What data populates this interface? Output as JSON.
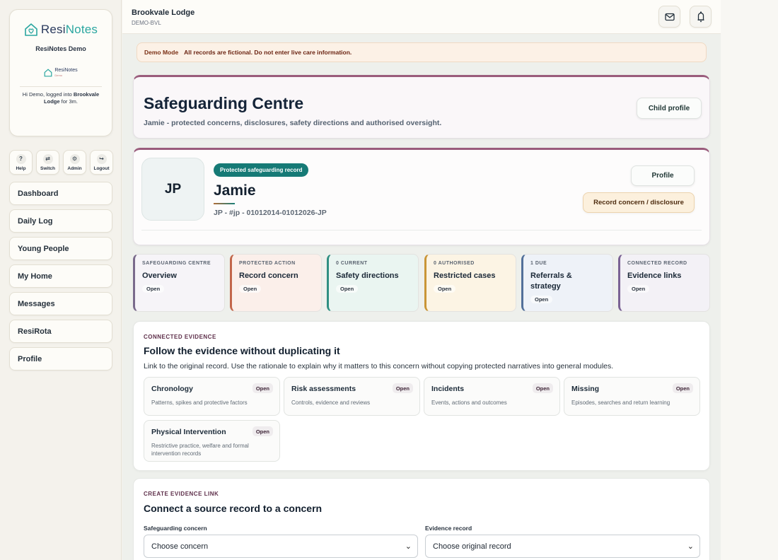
{
  "sidebar": {
    "brand_name_a": "Resi",
    "brand_name_b": "Notes",
    "org_name": "ResiNotes Demo",
    "mini_logo_a": "ResiNotes",
    "mini_logo_b": "Demo",
    "login_prefix": "Hi Demo, logged into ",
    "login_home": "Brookvale Lodge",
    "login_suffix": " for 3m.",
    "quick": [
      {
        "icon": "?",
        "label": "Help"
      },
      {
        "icon": "⇄",
        "label": "Switch"
      },
      {
        "icon": "⚙",
        "label": "Admin"
      },
      {
        "icon": "↪",
        "label": "Logout"
      }
    ],
    "nav": [
      "Dashboard",
      "Daily Log",
      "Young People",
      "My Home",
      "Messages",
      "ResiRota",
      "Profile"
    ]
  },
  "topbar": {
    "home_name": "Brookvale Lodge",
    "home_code": "DEMO-BVL"
  },
  "banner": {
    "tag": "Demo Mode",
    "message": "All records are fictional. Do not enter live care information."
  },
  "hero": {
    "title": "Safeguarding Centre",
    "subtitle": "Jamie - protected concerns, disclosures, safety directions and authorised oversight.",
    "child_profile_btn": "Child profile"
  },
  "child": {
    "initials": "JP",
    "badge": "Protected safeguarding record",
    "name": "Jamie",
    "identifier": "JP - #jp - 01012014-01012026-JP",
    "profile_btn": "Profile",
    "record_btn": "Record concern / disclosure"
  },
  "tiles": [
    {
      "kicker": "SAFEGUARDING CENTRE",
      "title": "Overview",
      "open": "Open",
      "border": "#7a6a8c",
      "bg": "#f6f4f8"
    },
    {
      "kicker": "PROTECTED ACTION",
      "title": "Record concern",
      "open": "Open",
      "border": "#c2664a",
      "bg": "#fbefea"
    },
    {
      "kicker": "0 CURRENT",
      "title": "Safety directions",
      "open": "Open",
      "border": "#2f8f82",
      "bg": "#eaf5f1"
    },
    {
      "kicker": "0 AUTHORISED",
      "title": "Restricted cases",
      "open": "Open",
      "border": "#c99536",
      "bg": "#fcf4e4"
    },
    {
      "kicker": "1 DUE",
      "title": "Referrals & strategy",
      "open": "Open",
      "border": "#52709a",
      "bg": "#eef2f8"
    },
    {
      "kicker": "CONNECTED RECORD",
      "title": "Evidence links",
      "open": "Open",
      "border": "#7a6294",
      "bg": "#f3f1f6"
    }
  ],
  "evidence": {
    "kicker": "CONNECTED EVIDENCE",
    "title": "Follow the evidence without duplicating it",
    "description": "Link to the original record. Use the rationale to explain why it matters to this concern without copying protected narratives into general modules.",
    "items": [
      {
        "name": "Chronology",
        "desc": "Patterns, spikes and protective factors",
        "open": "Open"
      },
      {
        "name": "Risk assessments",
        "desc": "Controls, evidence and reviews",
        "open": "Open"
      },
      {
        "name": "Incidents",
        "desc": "Events, actions and outcomes",
        "open": "Open"
      },
      {
        "name": "Missing",
        "desc": "Episodes, searches and return learning",
        "open": "Open"
      },
      {
        "name": "Physical Intervention",
        "desc": "Restrictive practice, welfare and formal intervention records",
        "open": "Open"
      }
    ]
  },
  "create": {
    "kicker": "CREATE EVIDENCE LINK",
    "title": "Connect a source record to a concern",
    "concern_label": "Safeguarding concern",
    "concern_value": "Choose concern",
    "record_label": "Evidence record",
    "record_value": "Choose original record"
  }
}
